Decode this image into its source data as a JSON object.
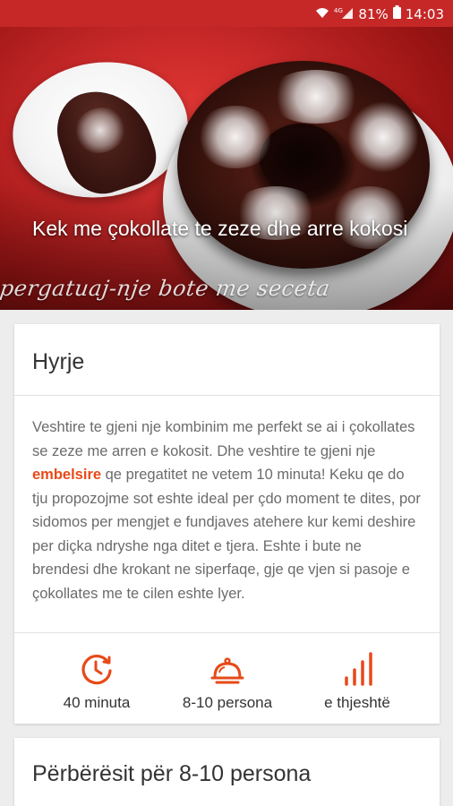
{
  "status_bar": {
    "battery": "81%",
    "time": "14:03",
    "network": "4G"
  },
  "hero": {
    "title": "Kek me çokollate te zeze dhe arre kokosi",
    "watermark": "pergatuaj-nje bote me seceta"
  },
  "intro": {
    "heading": "Hyrje",
    "text_before_link": "Veshtire te gjeni nje kombinim me perfekt se ai i çokollates se zeze me arren e kokosit. Dhe veshtire te gjeni nje ",
    "link_text": "embelsire",
    "text_after_link": " qe pregatitet ne vetem 10 minuta! Keku qe do tju propozojme sot eshte ideal per çdo moment te dites, por sidomos per mengjet e fundjaves atehere kur kemi deshire per diçka ndryshe nga ditet e tjera. Eshte i bute ne brendesi dhe krokant ne siperfaqe, gje qe vjen si pasoje e çokollates me te cilen eshte lyer."
  },
  "meta": {
    "time_label": "40 minuta",
    "servings_label": "8-10 persona",
    "difficulty_label": "e thjeshtë"
  },
  "ingredients": {
    "heading": "Përbërësit për 8-10 persona"
  },
  "colors": {
    "status_bar": "#c62828",
    "accent": "#e64a19",
    "background": "#ededed"
  },
  "icons": {
    "time": "clock-timer-icon",
    "servings": "serving-dish-icon",
    "difficulty": "signal-bars-icon"
  }
}
